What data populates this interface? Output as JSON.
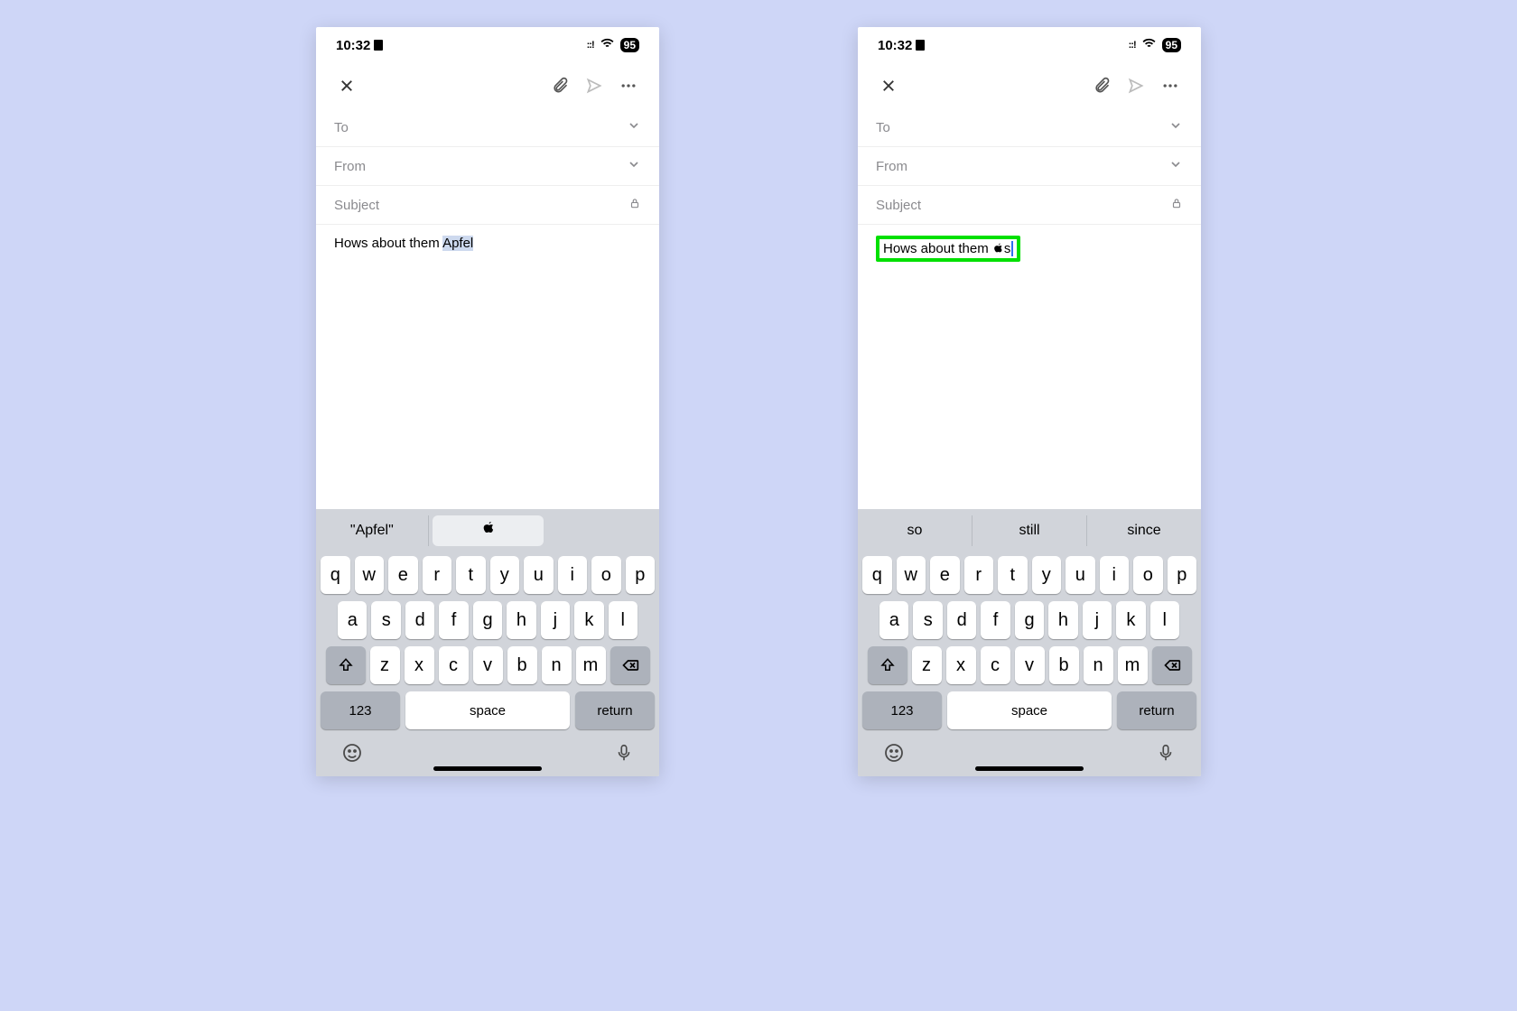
{
  "status": {
    "time": "10:32",
    "battery": "95"
  },
  "compose": {
    "to": "To",
    "from": "From",
    "subject": "Subject"
  },
  "left": {
    "body_prefix": "Hows about them ",
    "body_selected": "Apfel",
    "suggestions": {
      "a": "\"Apfel\"",
      "b_icon": "apple-logo"
    }
  },
  "right": {
    "body_prefix": "Hows about them ",
    "body_logo_after": "s",
    "suggestions": {
      "a": "so",
      "b": "still",
      "c": "since"
    }
  },
  "kbd": {
    "row1": [
      "q",
      "w",
      "e",
      "r",
      "t",
      "y",
      "u",
      "i",
      "o",
      "p"
    ],
    "row2": [
      "a",
      "s",
      "d",
      "f",
      "g",
      "h",
      "j",
      "k",
      "l"
    ],
    "row3": [
      "z",
      "x",
      "c",
      "v",
      "b",
      "n",
      "m"
    ],
    "numkey": "123",
    "space": "space",
    "return": "return"
  }
}
